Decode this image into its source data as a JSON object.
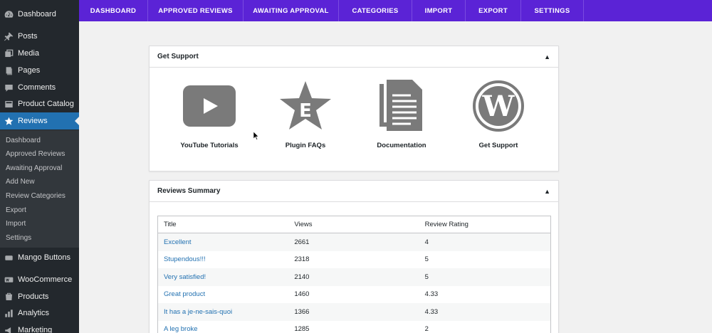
{
  "sidebar": {
    "items": [
      {
        "label": "Dashboard",
        "icon": "dashboard-icon"
      },
      {
        "label": "Posts",
        "icon": "pin-icon"
      },
      {
        "label": "Media",
        "icon": "media-icon"
      },
      {
        "label": "Pages",
        "icon": "pages-icon"
      },
      {
        "label": "Comments",
        "icon": "comments-icon"
      },
      {
        "label": "Product Catalog",
        "icon": "catalog-icon"
      },
      {
        "label": "Reviews",
        "icon": "star-icon",
        "active": true
      },
      {
        "label": "Mango Buttons",
        "icon": "mango-icon"
      },
      {
        "label": "WooCommerce",
        "icon": "woocommerce-icon"
      },
      {
        "label": "Products",
        "icon": "products-icon"
      },
      {
        "label": "Analytics",
        "icon": "analytics-icon"
      },
      {
        "label": "Marketing",
        "icon": "marketing-icon"
      }
    ],
    "submenu": [
      "Dashboard",
      "Approved Reviews",
      "Awaiting Approval",
      "Add New",
      "Review Categories",
      "Export",
      "Import",
      "Settings"
    ]
  },
  "topnav": {
    "tabs": [
      "DASHBOARD",
      "APPROVED REVIEWS",
      "AWAITING APPROVAL",
      "CATEGORIES",
      "IMPORT",
      "EXPORT",
      "SETTINGS"
    ],
    "color": "#5b23d6"
  },
  "support": {
    "title": "Get Support",
    "items": [
      {
        "label": "YouTube Tutorials",
        "icon": "youtube-icon"
      },
      {
        "label": "Plugin FAQs",
        "icon": "faq-star-icon"
      },
      {
        "label": "Documentation",
        "icon": "documentation-icon"
      },
      {
        "label": "Get Support",
        "icon": "wordpress-icon"
      }
    ]
  },
  "summary": {
    "title": "Reviews Summary",
    "columns": [
      "Title",
      "Views",
      "Review Rating"
    ],
    "rows": [
      [
        "Excellent",
        "2661",
        "4"
      ],
      [
        "Stupendous!!!",
        "2318",
        "5"
      ],
      [
        "Very satisfied!",
        "2140",
        "5"
      ],
      [
        "Great product",
        "1460",
        "4.33"
      ],
      [
        "It has a je-ne-sais-quoi",
        "1366",
        "4.33"
      ],
      [
        "A leg broke",
        "1285",
        "2"
      ]
    ]
  }
}
